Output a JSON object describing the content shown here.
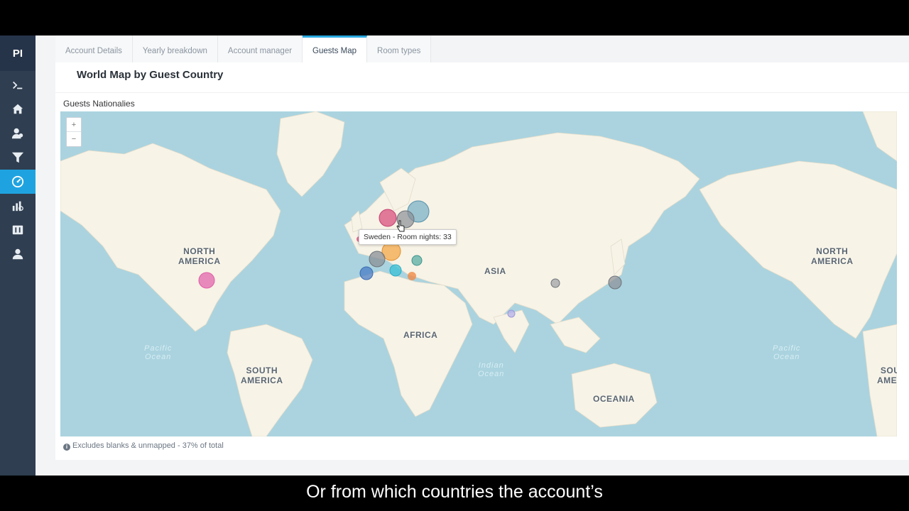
{
  "app": {
    "logo": "PI"
  },
  "sidebar": {
    "items": [
      {
        "icon": "terminal-icon",
        "active": false
      },
      {
        "icon": "home-icon",
        "active": false
      },
      {
        "icon": "users-icon",
        "active": false
      },
      {
        "icon": "filter-icon",
        "active": false
      },
      {
        "icon": "dashboard-icon",
        "active": true
      },
      {
        "icon": "report-icon",
        "active": false
      },
      {
        "icon": "tools-icon",
        "active": false
      },
      {
        "icon": "team-icon",
        "active": false
      }
    ]
  },
  "tabs": [
    {
      "label": "Account Details",
      "active": false
    },
    {
      "label": "Yearly breakdown",
      "active": false
    },
    {
      "label": "Account manager",
      "active": false
    },
    {
      "label": "Guests Map",
      "active": true
    },
    {
      "label": "Room types",
      "active": false
    }
  ],
  "panel": {
    "title": "World Map by Guest Country"
  },
  "card": {
    "title": "Guests Nationalies",
    "zoom_in": "+",
    "zoom_out": "−",
    "note": "Excludes blanks & unmapped - 37% of total"
  },
  "map": {
    "labels": {
      "north_america_left": "NORTH\nAMERICA",
      "north_america_right": "NORTH\nAMERICA",
      "south_america": "SOUTH\nAMERICA",
      "south_america_right": "SOU\nAMER",
      "asia": "ASIA",
      "africa": "AFRICA",
      "oceania": "OCEANIA",
      "pacific_left": "Pacific\nOcean",
      "pacific_right": "Pacific\nOcean",
      "indian": "Indian\nOcean"
    },
    "tooltip": "Sweden - Room nights: 33",
    "colors": {
      "water": "#aad3df",
      "land": "#f7f3e6"
    }
  },
  "subtitle": "Or from which countries the account’s"
}
